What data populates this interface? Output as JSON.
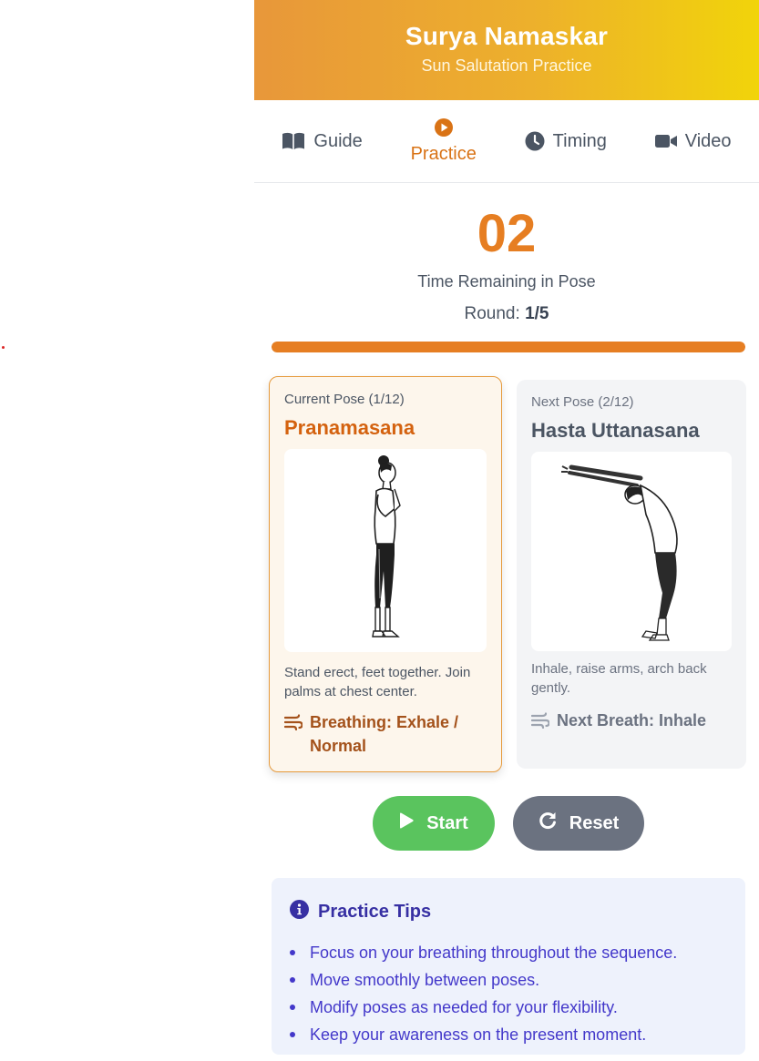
{
  "header": {
    "title": "Surya Namaskar",
    "subtitle": "Sun Salutation Practice",
    "gradient_start": "#e8973a",
    "gradient_end": "#f1d40a"
  },
  "tabs": [
    {
      "label": "Guide",
      "icon": "book-icon",
      "active": false
    },
    {
      "label": "Practice",
      "icon": "play-circle-icon",
      "active": true
    },
    {
      "label": "Timing",
      "icon": "clock-icon",
      "active": false
    },
    {
      "label": "Video",
      "icon": "video-camera-icon",
      "active": false
    }
  ],
  "timer": {
    "count": "02",
    "label": "Time Remaining in Pose",
    "round_label": "Round:",
    "round_value": "1/5",
    "progress_fraction": 1.0
  },
  "current_pose": {
    "index_label": "Current Pose (1/12)",
    "name": "Pranamasana",
    "description": "Stand erect, feet together. Join palms at chest center.",
    "breathing": "Breathing: Exhale / Normal",
    "illustration": "woman-standing-prayer-pose"
  },
  "next_pose": {
    "index_label": "Next Pose (2/12)",
    "name": "Hasta Uttanasana",
    "description": "Inhale, raise arms, arch back gently.",
    "breathing": "Next Breath: Inhale",
    "illustration": "woman-raised-arms-backbend"
  },
  "controls": {
    "start_label": "Start",
    "reset_label": "Reset"
  },
  "tips": {
    "title": "Practice Tips",
    "items": [
      "Focus on your breathing throughout the sequence.",
      "Move smoothly between poses.",
      "Modify poses as needed for your flexibility.",
      "Keep your awareness on the present moment."
    ]
  },
  "colors": {
    "accent": "#e67e22",
    "active_tab": "#d97316",
    "start_button": "#5ac45e",
    "reset_button": "#6b7280",
    "tips_text": "#4338ca"
  }
}
